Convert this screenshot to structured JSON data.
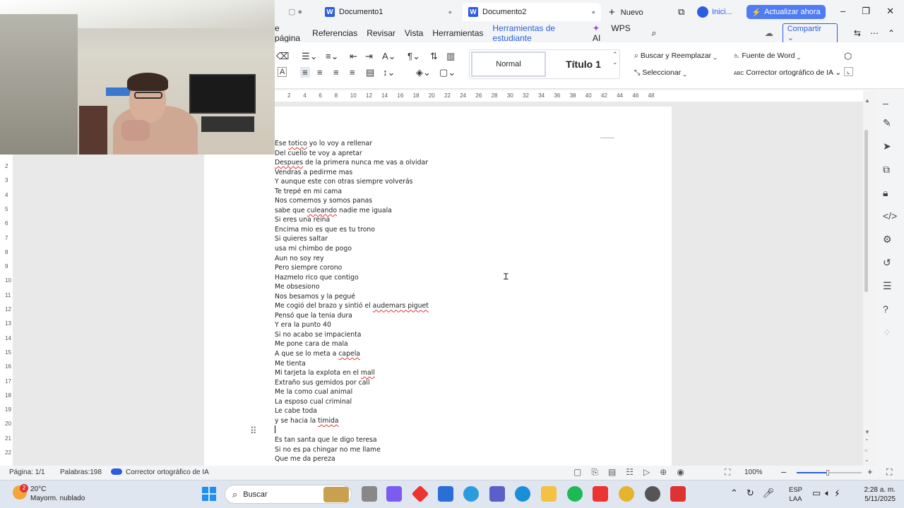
{
  "tabs": {
    "new_tab_label": "Nuevo",
    "doc1": "Documento1",
    "doc2": "Documento2",
    "signin": "Inici...",
    "upgrade": "Actualizar ahora"
  },
  "menu": [
    "e página",
    "Referencias",
    "Revisar",
    "Vista",
    "Herramientas",
    "Herramientas de estudiante",
    "WPS AI"
  ],
  "share_label": "Compartir",
  "ribbon": {
    "style_normal": "Normal",
    "style_title": "Título 1",
    "find_replace": "Buscar y Reemplazar",
    "select": "Seleccionar",
    "word_font": "Fuente de Word",
    "ai_corrector": "Corrector ortográfico de IA"
  },
  "ruler_numbers": [
    "2",
    "4",
    "6",
    "8",
    "10",
    "12",
    "14",
    "16",
    "18",
    "20",
    "22",
    "24",
    "26",
    "28",
    "30",
    "32",
    "34",
    "36",
    "38",
    "40",
    "42",
    "44",
    "46",
    "48"
  ],
  "vruler_numbers": [
    "2",
    "3",
    "4",
    "5",
    "6",
    "7",
    "8",
    "9",
    "10",
    "11",
    "12",
    "13",
    "14",
    "15",
    "16",
    "17",
    "18",
    "19",
    "20",
    "21",
    "22"
  ],
  "doc_lines": [
    "Ese totico yo lo voy a rellenar",
    "Del cuello te voy a apretar",
    "Despues de la primera nunca me vas a olvidar",
    "Vendras a pedirme mas",
    "Y aunque este con otras siempre volverás",
    "Te trepé en mi cama",
    "Nos comemos y somos panas",
    "sabe que culeando nadie me iguala",
    "Si eres una reina",
    "Encima mio es que es tu trono",
    "Si quieres saltar",
    "usa mi chimbo de pogo",
    "Aun no soy rey",
    "Pero siempre corono",
    "Hazmelo rico que contigo",
    "Me obsesiono",
    "Nos besamos y la pegué",
    "Me cogió del brazo y sintió el audemars piguet",
    "Pensó que la tenia dura",
    "Y era la punto 40",
    "Si no acabo se impacienta",
    "Me pone cara de mala",
    "A que se lo meta a capela",
    "Me tienta",
    "Mi tarjeta la explota en el mall",
    "Extraño sus gemidos por call",
    "Me la como cual animal",
    "La esposo cual criminal",
    "Le cabe toda",
    "y se hacia la timida",
    "",
    "Es tan santa que le digo teresa",
    "Si no es pa chingar no me llame",
    "Que me da pereza"
  ],
  "status": {
    "page": "Página: 1/1",
    "words": "Palabras:198",
    "ai": "Corrector ortográfico de IA",
    "zoom": "100%"
  },
  "taskbar": {
    "weather_temp": "20°C",
    "weather_desc": "Mayorm. nublado",
    "search": "Buscar",
    "lang1": "ESP",
    "lang2": "LAA",
    "time": "2:28 a. m.",
    "date": "5/11/2025",
    "badge": "2"
  }
}
